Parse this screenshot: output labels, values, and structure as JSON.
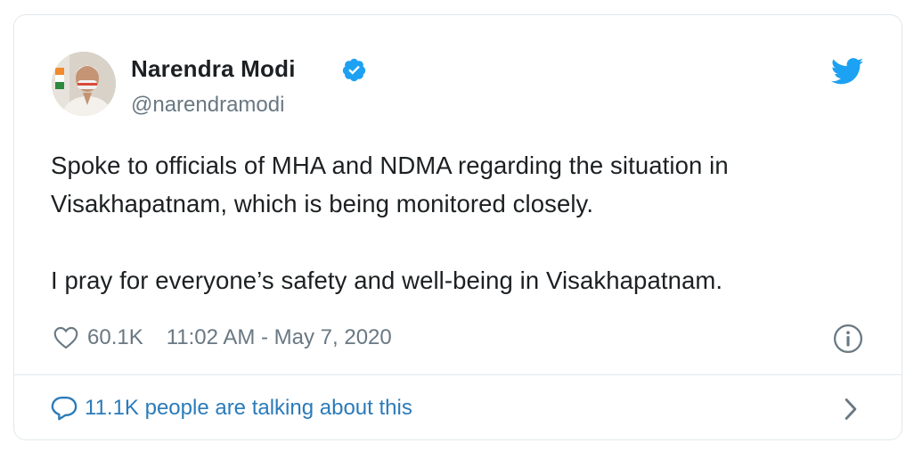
{
  "author": {
    "name": "Narendra Modi",
    "handle": "@narendramodi",
    "verified": true,
    "avatar_icon": "profile-photo"
  },
  "tweet": {
    "paragraphs": [
      "Spoke to officials of MHA and NDMA regarding the situation in Visakhapatnam, which is being monitored closely.",
      "I pray for everyone’s safety and well-being in Visakhapatnam."
    ],
    "likes": "60.1K",
    "timestamp": "11:02 AM - May 7, 2020"
  },
  "footer": {
    "talking_label": "11.1K people are talking about this"
  },
  "icons": {
    "brand": "twitter-bird-icon",
    "verified": "verified-badge-icon",
    "like": "heart-icon",
    "info": "info-icon",
    "reply": "speech-bubble-icon",
    "more": "chevron-right-icon"
  },
  "colors": {
    "brand_blue": "#1da1f2",
    "link_blue": "#2b7bb9",
    "muted_text": "#697882",
    "primary_text": "#1c2022",
    "border": "#e1e8ed"
  }
}
